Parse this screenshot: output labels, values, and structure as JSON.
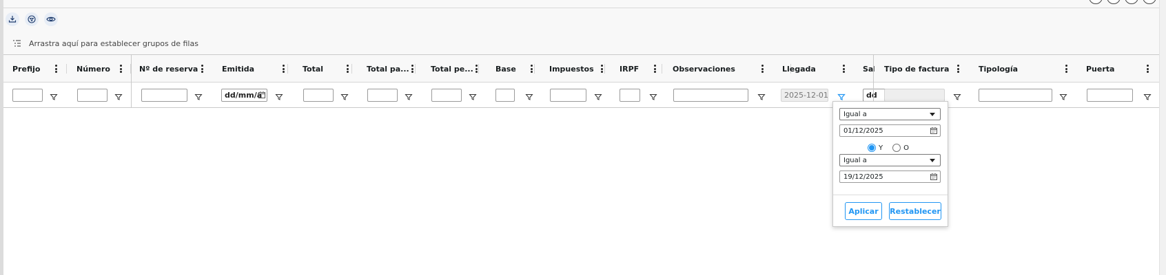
{
  "toolbar": {
    "buttons": [
      {
        "icon": "download-icon"
      },
      {
        "icon": "filter-icon"
      },
      {
        "icon": "eye-icon"
      }
    ]
  },
  "group_panel": {
    "text": "Arrastra aquí para establecer grupos de filas"
  },
  "columns": [
    {
      "label": "Prefijo",
      "filter_value": "",
      "filter_disabled": false
    },
    {
      "label": "Número",
      "filter_value": "",
      "filter_disabled": false
    },
    {
      "label": "Nº de reserva",
      "filter_value": "",
      "filter_disabled": false
    },
    {
      "label": "Emitida",
      "filter_value": "dd/mm/a",
      "filter_disabled": false
    },
    {
      "label": "Total",
      "filter_value": "",
      "filter_disabled": false
    },
    {
      "label": "Total pa...",
      "filter_value": "",
      "filter_disabled": false
    },
    {
      "label": "Total pe...",
      "filter_value": "",
      "filter_disabled": false
    },
    {
      "label": "Base",
      "filter_value": "",
      "filter_disabled": false
    },
    {
      "label": "Impuestos",
      "filter_value": "",
      "filter_disabled": false
    },
    {
      "label": "IRPF",
      "filter_value": "",
      "filter_disabled": false
    },
    {
      "label": "Observaciones",
      "filter_value": "",
      "filter_disabled": false
    },
    {
      "label": "Llegada",
      "filter_value": "2025-12-01",
      "filter_disabled": true,
      "filter_active": true
    },
    {
      "label": "Sali",
      "filter_value": "dd",
      "filter_disabled": false
    },
    {
      "label": "Tipo de factura",
      "filter_value": "",
      "filter_disabled": true
    },
    {
      "label": "Tipología",
      "filter_value": "",
      "filter_disabled": false
    },
    {
      "label": "Puerta",
      "filter_value": "",
      "filter_disabled": false
    }
  ],
  "filter_popup": {
    "condition1": {
      "operator": "Igual a",
      "date": "01/12/2025"
    },
    "join": {
      "and_label": "Y",
      "or_label": "O",
      "selected": "Y"
    },
    "condition2": {
      "operator": "Igual a",
      "date": "19/12/2025"
    },
    "apply_label": "Aplicar",
    "reset_label": "Restablecer"
  },
  "colors": {
    "accent": "#2196f3",
    "header_bg": "#f8f8f8",
    "border": "#c9c9c9"
  }
}
